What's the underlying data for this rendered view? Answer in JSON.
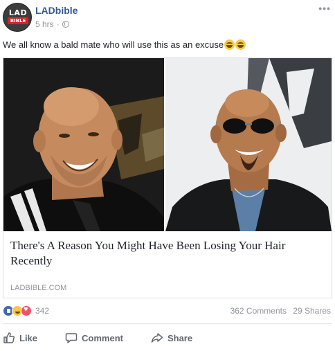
{
  "post": {
    "page_name": "LADbible",
    "time": "5 hrs",
    "separator": "·",
    "privacy_icon": "globe-icon",
    "menu_icon": "more-options-icon",
    "text": "We all know a bald mate who will use this as an excuse",
    "emojis": [
      "grinning-squinting-face",
      "grinning-squinting-face"
    ]
  },
  "avatar": {
    "line1": "LAD",
    "line2": "BIBLE"
  },
  "link": {
    "title": "There's A Reason You Might Have Been Losing Your Hair Recently",
    "domain": "LADBIBLE.COM",
    "images": [
      "bald-man-leather-jacket-mtv-backdrop",
      "bald-man-sunglasses-leather-jacket"
    ]
  },
  "stats": {
    "reaction_icons": [
      "like",
      "haha",
      "love"
    ],
    "reaction_count": "342",
    "comments": "362 Comments",
    "shares": "29 Shares"
  },
  "actions": {
    "like": "Like",
    "comment": "Comment",
    "share": "Share"
  },
  "colors": {
    "link_blue": "#365899",
    "meta_gray": "#90949c",
    "like_blue": "#4267b2",
    "love_red": "#f25268"
  }
}
